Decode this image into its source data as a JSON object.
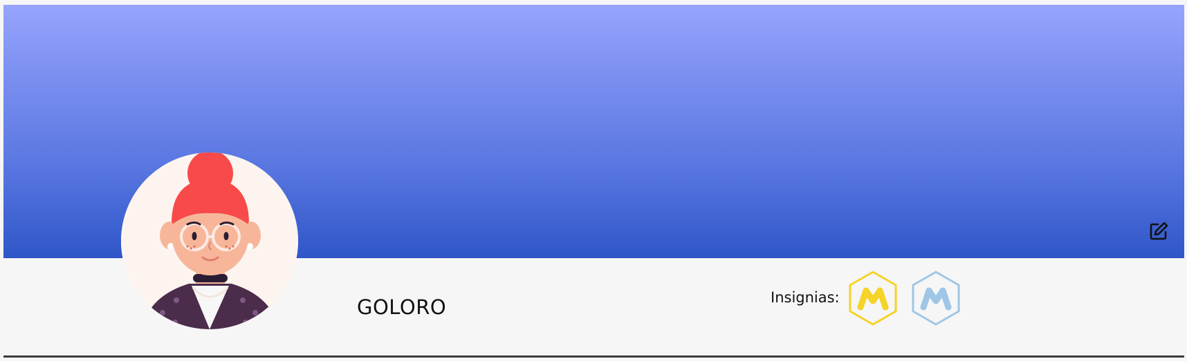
{
  "profile": {
    "username": "GOLORO",
    "avatar_icon": "avatar-woman-icon"
  },
  "banner": {
    "edit_icon": "edit-icon"
  },
  "badges": {
    "label": "Insignias:",
    "items": [
      {
        "icon": "hexagon-m-badge-icon",
        "color": "#f5d327"
      },
      {
        "icon": "hexagon-m-badge-icon",
        "color": "#9fc6e6"
      }
    ]
  },
  "colors": {
    "banner_top": "#96a4fd",
    "banner_bottom": "#2f56c8",
    "background": "#f6f6f6",
    "divider": "#3a3a3a"
  }
}
